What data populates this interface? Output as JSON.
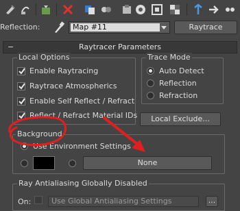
{
  "toolbar": {
    "icons": [
      "pick-material-icon",
      "put-material-icon",
      "assign-material-icon",
      "reset-map-icon",
      "copy-material-icon",
      "make-unique-icon",
      "put-to-library-icon",
      "material-id-channel-icon",
      "show-map-icon",
      "show-end-result-icon",
      "go-to-parent-icon",
      "go-forward-sibling-icon"
    ]
  },
  "reflection": {
    "label": "Reflection:",
    "map_value": "Map #11",
    "raytrace_label": "Raytrace"
  },
  "rollout": {
    "toggle": "−",
    "title": "Raytracer Parameters"
  },
  "local_options": {
    "title": "Local Options",
    "items": [
      {
        "label": "Enable Raytracing",
        "checked": true
      },
      {
        "label": "Raytrace Atmospherics",
        "checked": true
      },
      {
        "label": "Enable Self Reflect / Refract",
        "checked": true
      },
      {
        "label": "Reflect / Refract Material IDs",
        "checked": true
      }
    ]
  },
  "trace_mode": {
    "title": "Trace Mode",
    "options": [
      {
        "label": "Auto Detect",
        "selected": true
      },
      {
        "label": "Reflection",
        "selected": false
      },
      {
        "label": "Refraction",
        "selected": false
      }
    ]
  },
  "local_exclude_label": "Local Exclude...",
  "background": {
    "title": "Background",
    "use_env_label": "Use Environment Settings",
    "color": "#000000",
    "none_label": "None"
  },
  "antialias": {
    "title": "Ray Antialiasing Globally Disabled",
    "on_label": "On:",
    "select_value": "Use Global Antialiasing Settings",
    "dots_label": "..."
  },
  "annotation_color": "#e02020"
}
